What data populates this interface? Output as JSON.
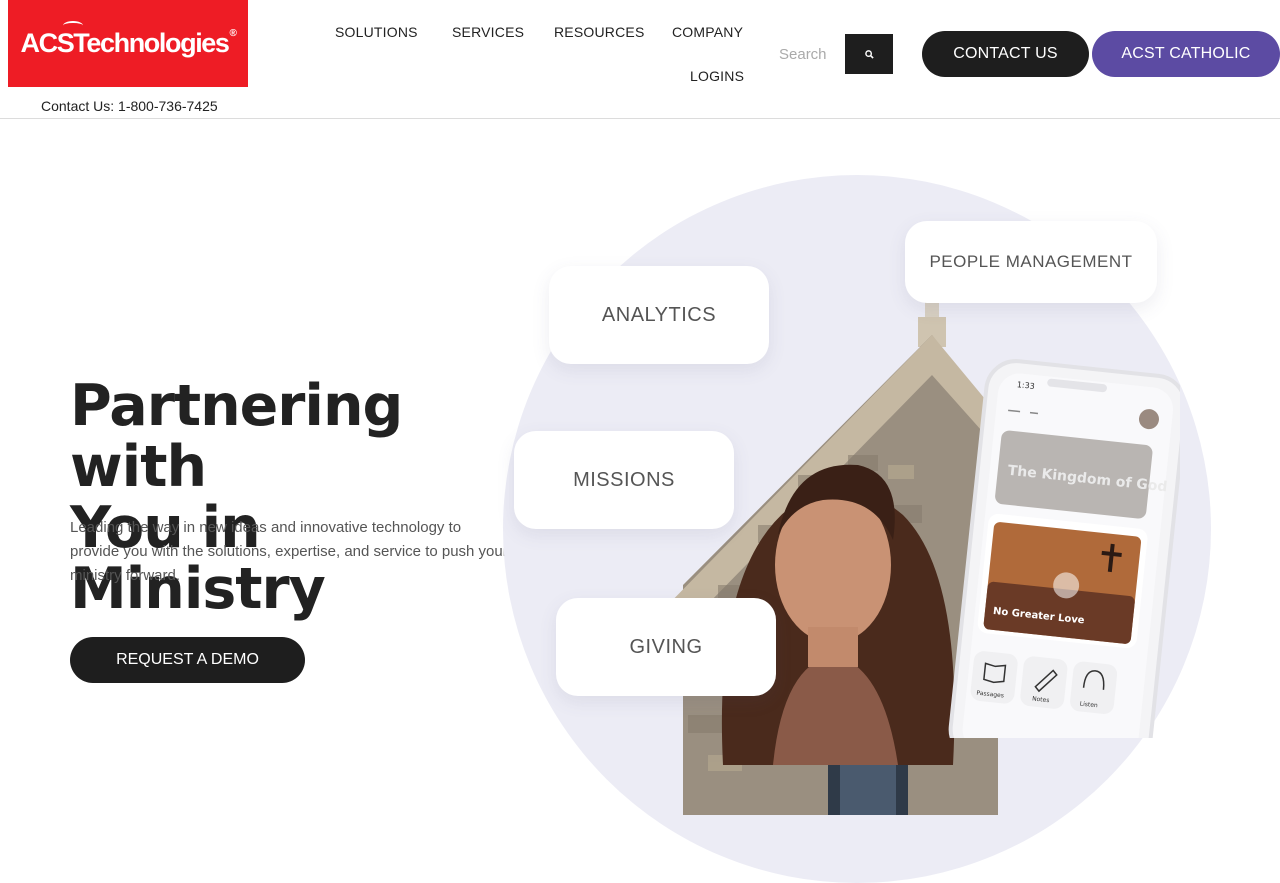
{
  "brand": {
    "logo_text": "ACSTechnologies",
    "logo_mark": "®",
    "contact_line": "Contact Us: 1-800-736-7425",
    "red": "#ee1c25"
  },
  "nav": {
    "items": [
      "SOLUTIONS",
      "SERVICES",
      "RESOURCES",
      "COMPANY",
      "LOGINS"
    ]
  },
  "search": {
    "placeholder": "Search",
    "icon": "search-icon"
  },
  "buttons": {
    "contact_us": "CONTACT US",
    "acst_catholic": "ACST CATHOLIC",
    "request_demo": "REQUEST A DEMO",
    "dark": "#1e1e1e",
    "purple": "#5c4ba3"
  },
  "hero": {
    "title_line1": "Partnering with",
    "title_line2": "You in Ministry",
    "subtitle": "Leading the way in new ideas and innovative technology to provide you with the solutions, expertise, and service to push your ministry forward."
  },
  "features": {
    "analytics": "ANALYTICS",
    "people_management": "PEOPLE MANAGEMENT",
    "missions": "MISSIONS",
    "giving": "GIVING"
  },
  "phone": {
    "time": "1:33",
    "card1_title": "The Kingdom of God",
    "card2_title": "No Greater Love",
    "tabs": [
      "Passages",
      "Notes",
      "Listen"
    ]
  }
}
